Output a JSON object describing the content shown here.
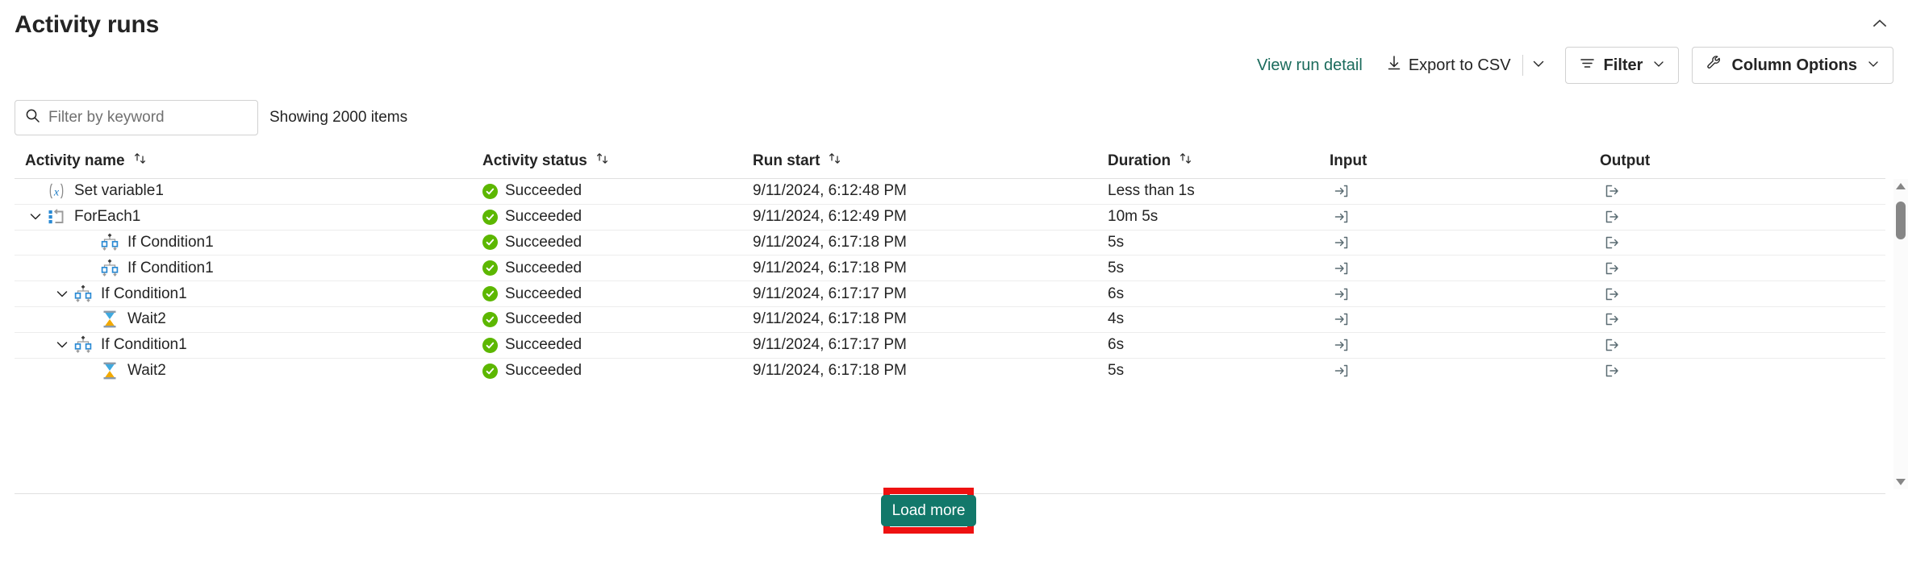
{
  "header": {
    "title": "Activity runs",
    "collapse_icon": "chevron-up-icon"
  },
  "toolbar": {
    "view_run_detail": "View run detail",
    "export_to_csv": "Export to CSV",
    "export_icon": "download-icon",
    "export_caret_icon": "chevron-down-icon",
    "filter_label": "Filter",
    "filter_icon": "filter-icon",
    "column_options_label": "Column Options",
    "column_options_icon": "wrench-icon",
    "chevron_icon": "chevron-down-icon"
  },
  "filter_bar": {
    "search_placeholder": "Filter by keyword",
    "search_value": "",
    "search_icon": "search-icon",
    "showing_items": "Showing 2000 items"
  },
  "table": {
    "columns": [
      {
        "label": "Activity name",
        "sortable": true,
        "sort_icon": "sort-arrows-icon"
      },
      {
        "label": "Activity status",
        "sortable": true,
        "sort_icon": "sort-arrows-icon"
      },
      {
        "label": "Run start",
        "sortable": true,
        "sort_icon": "sort-arrows-icon"
      },
      {
        "label": "Duration",
        "sortable": true,
        "sort_icon": "sort-arrows-icon"
      },
      {
        "label": "Input",
        "sortable": false,
        "sort_icon": ""
      },
      {
        "label": "Output",
        "sortable": false,
        "sort_icon": ""
      }
    ],
    "rows": [
      {
        "name": "Set variable1",
        "icon": "set-variable-icon",
        "indent": 1,
        "expander": "none",
        "status": "Succeeded",
        "status_icon": "success-check-icon",
        "run_start": "9/11/2024, 6:12:48 PM",
        "duration": "Less than 1s",
        "input_icon": "input-arrow-icon",
        "output_icon": "output-arrow-icon"
      },
      {
        "name": "ForEach1",
        "icon": "foreach-icon",
        "indent": 0,
        "expander": "expanded",
        "status": "Succeeded",
        "status_icon": "success-check-icon",
        "run_start": "9/11/2024, 6:12:49 PM",
        "duration": "10m 5s",
        "input_icon": "input-arrow-icon",
        "output_icon": "output-arrow-icon"
      },
      {
        "name": "If Condition1",
        "icon": "if-condition-icon",
        "indent": 3,
        "expander": "none",
        "status": "Succeeded",
        "status_icon": "success-check-icon",
        "run_start": "9/11/2024, 6:17:18 PM",
        "duration": "5s",
        "input_icon": "input-arrow-icon",
        "output_icon": "output-arrow-icon"
      },
      {
        "name": "If Condition1",
        "icon": "if-condition-icon",
        "indent": 3,
        "expander": "none",
        "status": "Succeeded",
        "status_icon": "success-check-icon",
        "run_start": "9/11/2024, 6:17:18 PM",
        "duration": "5s",
        "input_icon": "input-arrow-icon",
        "output_icon": "output-arrow-icon"
      },
      {
        "name": "If Condition1",
        "icon": "if-condition-icon",
        "indent": 2,
        "expander": "expanded",
        "status": "Succeeded",
        "status_icon": "success-check-icon",
        "run_start": "9/11/2024, 6:17:17 PM",
        "duration": "6s",
        "input_icon": "input-arrow-icon",
        "output_icon": "output-arrow-icon"
      },
      {
        "name": "Wait2",
        "icon": "wait-hourglass-icon",
        "indent": 3,
        "expander": "none",
        "status": "Succeeded",
        "status_icon": "success-check-icon",
        "run_start": "9/11/2024, 6:17:18 PM",
        "duration": "4s",
        "input_icon": "input-arrow-icon",
        "output_icon": "output-arrow-icon"
      },
      {
        "name": "If Condition1",
        "icon": "if-condition-icon",
        "indent": 2,
        "expander": "expanded",
        "status": "Succeeded",
        "status_icon": "success-check-icon",
        "run_start": "9/11/2024, 6:17:17 PM",
        "duration": "6s",
        "input_icon": "input-arrow-icon",
        "output_icon": "output-arrow-icon"
      },
      {
        "name": "Wait2",
        "icon": "wait-hourglass-icon",
        "indent": 3,
        "expander": "none",
        "status": "Succeeded",
        "status_icon": "success-check-icon",
        "run_start": "9/11/2024, 6:17:18 PM",
        "duration": "5s",
        "input_icon": "input-arrow-icon",
        "output_icon": "output-arrow-icon"
      }
    ]
  },
  "scrollbar": {
    "up_icon": "scroll-up-arrow-icon",
    "down_icon": "scroll-down-arrow-icon"
  },
  "footer": {
    "load_more_label": "Load more"
  },
  "colors": {
    "accent_teal": "#12786a",
    "link_teal": "#1b6b5c",
    "status_success_green": "#5cb700",
    "highlight_red": "#ee1111",
    "text": "#242424",
    "border": "#d1d1d1",
    "row_border": "#ededed"
  }
}
